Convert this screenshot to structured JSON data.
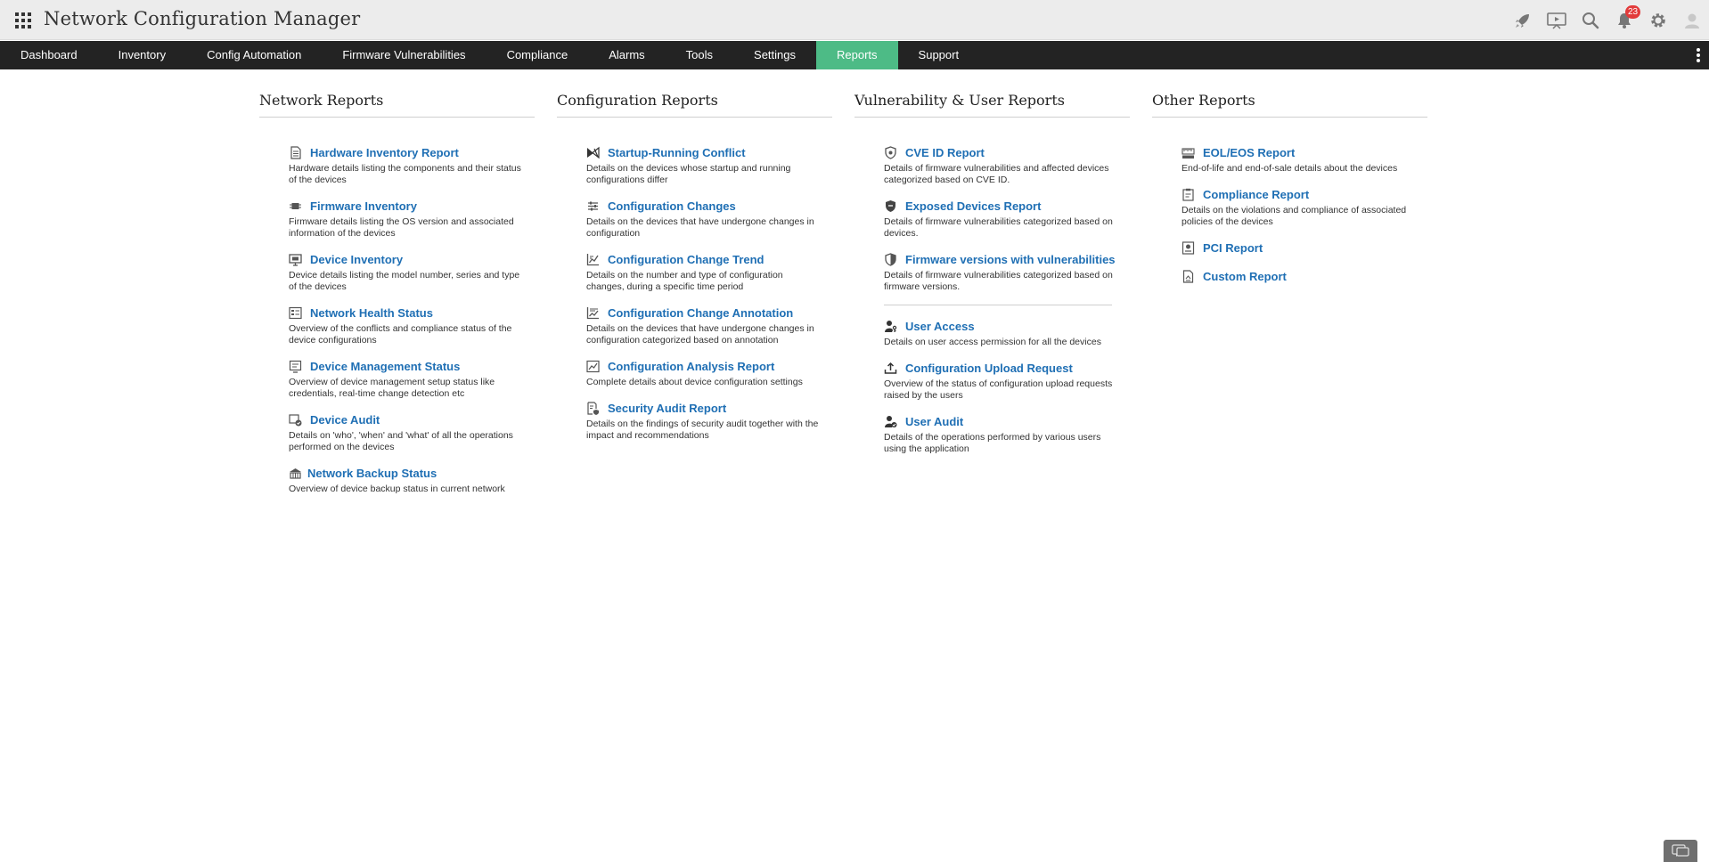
{
  "app": {
    "title": "Network Configuration Manager",
    "notification_count": "23",
    "icons": [
      "rocket-icon",
      "presentation-icon",
      "search-icon",
      "bell-icon",
      "gear-icon",
      "user-avatar-icon"
    ]
  },
  "nav": {
    "items": [
      "Dashboard",
      "Inventory",
      "Config Automation",
      "Firmware Vulnerabilities",
      "Compliance",
      "Alarms",
      "Tools",
      "Settings",
      "Reports",
      "Support"
    ],
    "active": "Reports",
    "active_color": "#4dbb86"
  },
  "columns": [
    {
      "title": "Network Reports",
      "reports": [
        {
          "label": "Hardware Inventory Report",
          "desc": "Hardware details listing the components and their status of the devices",
          "icon": "document-icon"
        },
        {
          "label": "Firmware Inventory",
          "desc": "Firmware details listing the OS version and associated information of the devices",
          "icon": "chip-icon"
        },
        {
          "label": "Device Inventory",
          "desc": "Device details listing the model number, series and type of the devices",
          "icon": "monitor-icon"
        },
        {
          "label": "Network Health Status",
          "desc": "Overview of the conflicts and compliance status of the device configurations",
          "icon": "health-list-icon"
        },
        {
          "label": "Device Management Status",
          "desc": "Overview of device management setup status like credentials, real-time change detection etc",
          "icon": "device-management-icon"
        },
        {
          "label": "Device Audit",
          "desc": "Details on 'who', 'when' and 'what' of all the operations performed on the devices",
          "icon": "audit-check-icon"
        },
        {
          "label": "Network Backup Status",
          "desc": "Overview of device backup status in current network",
          "icon": "backup-icon"
        }
      ]
    },
    {
      "title": "Configuration Reports",
      "reports": [
        {
          "label": "Startup-Running Conflict",
          "desc": "Details on the devices whose startup and running configurations differ",
          "icon": "conflict-icon"
        },
        {
          "label": "Configuration Changes",
          "desc": "Details on the devices that have undergone changes in configuration",
          "icon": "sliders-icon"
        },
        {
          "label": "Configuration Change Trend",
          "desc": "Details on the number and type of configuration changes, during a specific time period",
          "icon": "trend-chart-icon"
        },
        {
          "label": "Configuration Change Annotation",
          "desc": "Details on the devices that have undergone changes in configuration categorized based on annotation",
          "icon": "annotation-chart-icon"
        },
        {
          "label": "Configuration Analysis Report",
          "desc": "Complete details about device configuration settings",
          "icon": "analysis-chart-icon"
        },
        {
          "label": "Security Audit Report",
          "desc": "Details on the findings of security audit together with the impact and recommendations",
          "icon": "security-doc-icon"
        }
      ]
    },
    {
      "title": "Vulnerability & User Reports",
      "reports": [
        {
          "label": "CVE ID Report",
          "desc": "Details of firmware vulnerabilities and affected devices categorized based on CVE ID.",
          "icon": "shield-icon"
        },
        {
          "label": "Exposed Devices Report",
          "desc": "Details of firmware vulnerabilities categorized based on devices.",
          "icon": "shield-filled-icon"
        },
        {
          "label": "Firmware versions with vulnerabilities",
          "desc": "Details of firmware vulnerabilities categorized based on firmware versions.",
          "icon": "shield-half-icon"
        }
      ],
      "user_reports": [
        {
          "label": "User Access",
          "desc": "Details on user access permission for all the devices",
          "icon": "user-key-icon"
        },
        {
          "label": "Configuration Upload Request",
          "desc": "Overview of the status of configuration upload requests raised by the users",
          "icon": "upload-icon"
        },
        {
          "label": "User Audit",
          "desc": "Details of the operations performed by various users using the application",
          "icon": "user-audit-icon"
        }
      ]
    },
    {
      "title": "Other Reports",
      "reports": [
        {
          "label": "EOL/EOS Report",
          "desc": "End-of-life and end-of-sale details about the devices",
          "icon": "eol-icon"
        },
        {
          "label": "Compliance Report",
          "desc": "Details on the violations and compliance of associated policies of the devices",
          "icon": "clipboard-icon"
        },
        {
          "label": "PCI Report",
          "desc": "",
          "icon": "pci-icon"
        },
        {
          "label": "Custom Report",
          "desc": "",
          "icon": "custom-doc-icon"
        }
      ]
    }
  ]
}
